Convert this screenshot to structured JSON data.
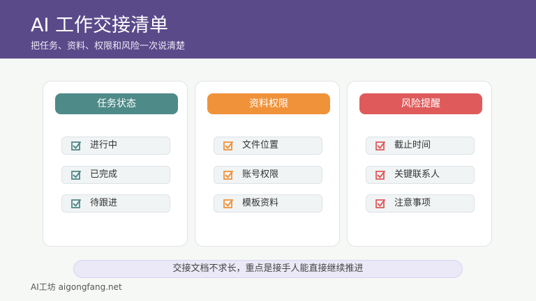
{
  "header": {
    "title": "AI 工作交接清单",
    "subtitle": "把任务、资料、权限和风险一次说清楚"
  },
  "columns": [
    {
      "title": "任务状态",
      "color": "#4e8a88",
      "items": [
        {
          "label": "进行中",
          "icon": "checked-checkbox-icon"
        },
        {
          "label": "已完成",
          "icon": "checked-checkbox-icon"
        },
        {
          "label": "待跟进",
          "icon": "checked-checkbox-icon"
        }
      ]
    },
    {
      "title": "资料权限",
      "color": "#f0923a",
      "items": [
        {
          "label": "文件位置",
          "icon": "checked-checkbox-icon"
        },
        {
          "label": "账号权限",
          "icon": "checked-checkbox-icon"
        },
        {
          "label": "模板资料",
          "icon": "checked-checkbox-icon"
        }
      ]
    },
    {
      "title": "风险提醒",
      "color": "#df5b5b",
      "items": [
        {
          "label": "截止时间",
          "icon": "checked-checkbox-icon"
        },
        {
          "label": "关键联系人",
          "icon": "checked-checkbox-icon"
        },
        {
          "label": "注意事项",
          "icon": "checked-checkbox-icon"
        }
      ]
    }
  ],
  "footer": {
    "note": "交接文档不求长，重点是接手人能直接继续推进",
    "brand": "AI工坊 aigongfang.net"
  }
}
